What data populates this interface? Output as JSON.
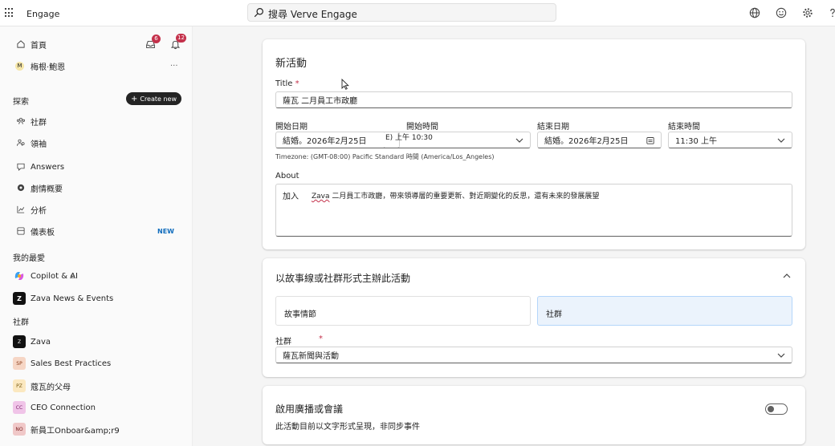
{
  "header": {
    "app_name": "Engage",
    "search_placeholder": "搜尋 Verve Engage"
  },
  "sidebar": {
    "home": "首頁",
    "inbox_count": "6",
    "notif_count": "12",
    "user_initial": "M",
    "user_name": "梅根·鮑恩",
    "more": "···",
    "explore_title": "探索",
    "create_new": "Create new",
    "nav": [
      {
        "label": "社群"
      },
      {
        "label": "領袖"
      },
      {
        "label": "Answers"
      },
      {
        "label": "劇情概要"
      },
      {
        "label": "分析"
      },
      {
        "label": "儀表板",
        "tag": "NEW"
      }
    ],
    "favorites_title": "我的最愛",
    "favorites": [
      {
        "label": "Copilot & AI",
        "check": "⊘"
      },
      {
        "label": "Zava News & Events"
      }
    ],
    "communities_title": "社群",
    "communities": [
      {
        "label": "Zava",
        "initials": "Z",
        "bg": "#111111",
        "fg": "#ffffff"
      },
      {
        "label": "Sales Best Practices",
        "initials": "SP",
        "bg": "#f6d6c5",
        "fg": "#8a3a16"
      },
      {
        "label": "蔻瓦的父母",
        "initials": "PZ",
        "bg": "#fbe8c0",
        "fg": "#7a5a10"
      },
      {
        "label": "CEO Connection",
        "initials": "CC",
        "bg": "#f0c4e8",
        "fg": "#7a1f6a"
      },
      {
        "label": "新員工Onboar&amp;r9",
        "initials": "NO",
        "bg": "#f0c8c8",
        "fg": "#7a1f1f"
      }
    ]
  },
  "event_form": {
    "heading": "新活動",
    "title_label": "Title",
    "required_mark": "*",
    "title_value": "薩瓦 二月員工市政廳",
    "start_date_label": "開始日期",
    "start_date_value": "結婚。2026年2月25日",
    "start_time_label": "開始時間",
    "start_time_value": "E) 上午 10:30",
    "end_date_label": "結束日期",
    "end_date_value": "結婚。2026年2月25日",
    "end_time_label": "結束時間",
    "end_time_value": "11:30 上午",
    "timezone": "Timezone: (GMT-08:00) Pacific Standard 時間 (America/Los_Angeles)",
    "about_label": "About",
    "about_prefix": "加入",
    "about_highlight": "Zava",
    "about_text": " 二月員工市政廳，帶來領導層的重要更新、對近期變化的反思，還有未來的發展展望"
  },
  "host_section": {
    "heading": "以故事線或社群形式主辦此活動",
    "option_storyline": "故事情節",
    "option_community": "社群",
    "community_label": "社群",
    "required_mark": "*",
    "community_value": "薩瓦新聞與活動"
  },
  "broadcast_section": {
    "heading": "啟用廣播或會議",
    "description": "此活動目前以文字形式呈現，非同步事件",
    "toggle_on": false
  },
  "colors": {
    "accent": "#0f6cbd",
    "badge": "#c4314b",
    "selected_option_bg": "#ebf3fc"
  }
}
